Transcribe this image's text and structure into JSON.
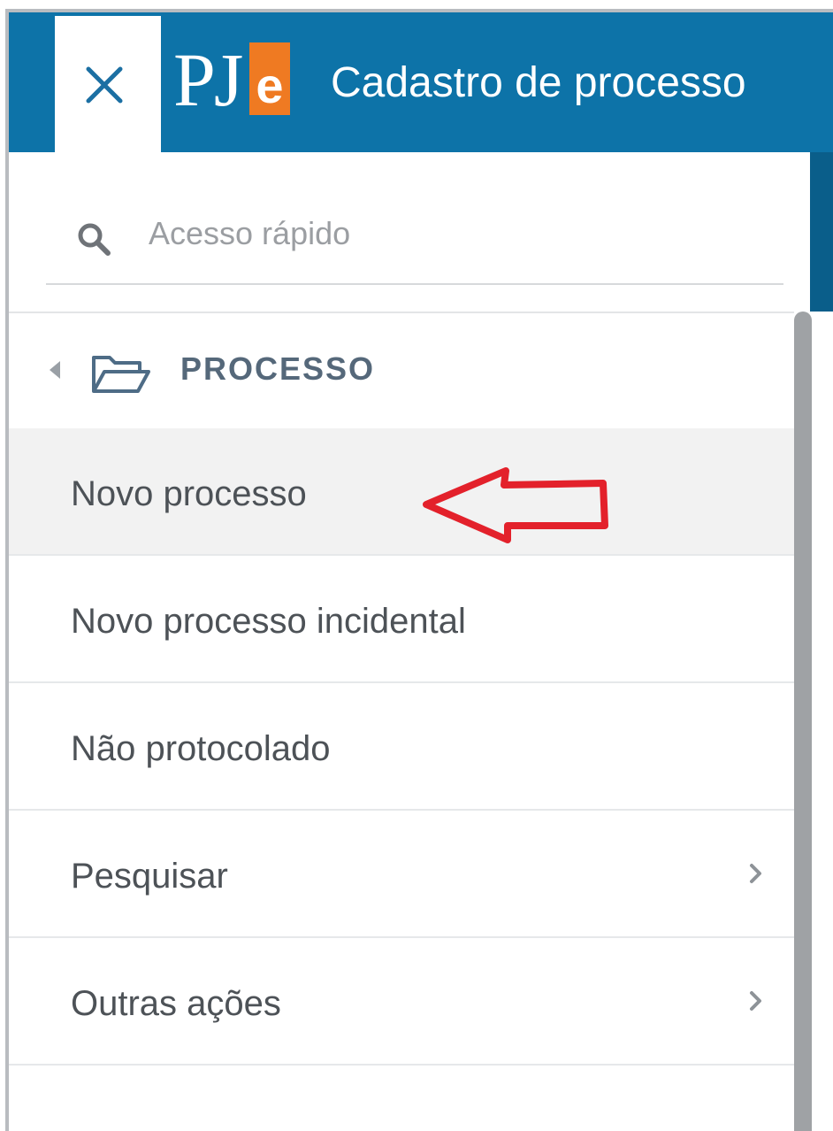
{
  "header": {
    "close_icon": "close-icon",
    "logo": {
      "letters": "PJ",
      "accent_letter": "e",
      "accent_color": "#ef7a22"
    },
    "title": "Cadastro de processo",
    "background_color": "#0d73a8"
  },
  "search": {
    "placeholder": "Acesso rápido",
    "icon": "search-icon"
  },
  "section": {
    "label": "PROCESSO",
    "icon": "folder-open-icon",
    "caret_icon": "caret-left-icon"
  },
  "menu": {
    "items": [
      {
        "label": "Novo processo",
        "active": true
      },
      {
        "label": "Novo processo incidental",
        "active": false
      },
      {
        "label": "Não protocolado",
        "active": false
      },
      {
        "label": "Pesquisar",
        "has_submenu": true
      },
      {
        "label": "Outras ações",
        "has_submenu": true
      }
    ]
  },
  "annotation": {
    "type": "arrow-left",
    "color": "#e3212b"
  }
}
